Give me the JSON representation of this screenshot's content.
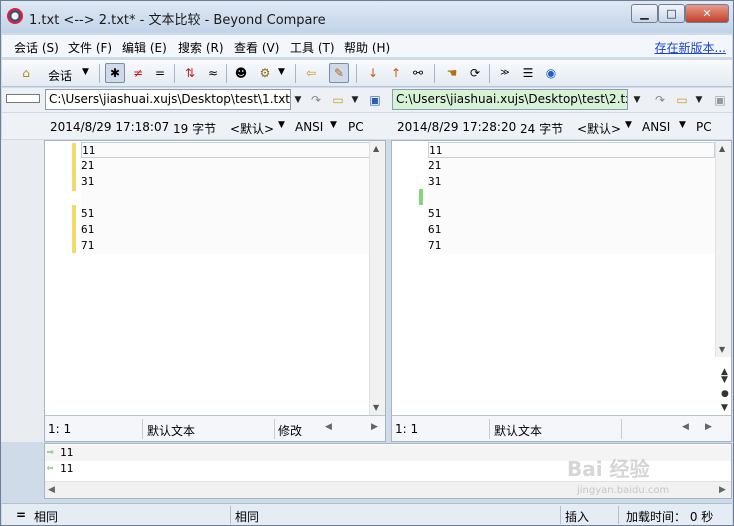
{
  "window": {
    "title": "1.txt <--> 2.txt* - 文本比较 - Beyond Compare"
  },
  "window_buttons": {
    "minimize": "▁",
    "maximize": "□",
    "close": "✕"
  },
  "menu": {
    "items": [
      "会话 (S)",
      "文件 (F)",
      "编辑 (E)",
      "搜索 (R)",
      "查看 (V)",
      "工具 (T)",
      "帮助 (H)"
    ],
    "link": "存在新版本..."
  },
  "toolbar": {
    "session_label": "会话",
    "icons": [
      "home-icon",
      "session-dropdown",
      "show-all-icon",
      "show-diffs-icon",
      "show-same-icon",
      "rules-icon",
      "similar-icon",
      "person-icon",
      "gear-icon",
      "copy-left-icon",
      "edit-icon",
      "next-diff-icon",
      "prev-diff-icon",
      "find-icon",
      "swap-icon",
      "refresh-icon",
      "expand-icon",
      "list-icon",
      "web-icon"
    ]
  },
  "left": {
    "path": "C:\\Users\\jiashuai.xujs\\Desktop\\test\\1.txt",
    "timestamp": "2014/8/29 17:18:07",
    "size": "19 字节",
    "format": "<默认>",
    "encoding": "ANSI",
    "line_end": "PC",
    "lines": [
      "11",
      "21",
      "31",
      "",
      "51",
      "61",
      "71"
    ],
    "status": {
      "pos": "1: 1",
      "mode": "默认文本",
      "state": "修改"
    }
  },
  "right": {
    "path": "C:\\Users\\jiashuai.xujs\\Desktop\\test\\2.txt",
    "timestamp": "2014/8/29 17:28:20",
    "size": "24 字节",
    "format": "<默认>",
    "encoding": "ANSI",
    "line_end": "PC",
    "lines": [
      "11",
      "21",
      "31",
      "",
      "51",
      "61",
      "71"
    ],
    "status": {
      "pos": "1: 1",
      "mode": "默认文本"
    }
  },
  "preview": {
    "line1": "11",
    "line2": "11"
  },
  "statusbar": {
    "left_sym": "=",
    "left": "相同",
    "middle": "相同",
    "insert": "插入",
    "load_time": "加载时间： 0 秒"
  },
  "watermark": {
    "brand": "Bai 经验",
    "url": "jingyan.baidu.com"
  },
  "colors": {
    "modified_marker": "#f3da6d",
    "added_marker": "#86d779",
    "right_path_bg": "#d8f2d6"
  }
}
